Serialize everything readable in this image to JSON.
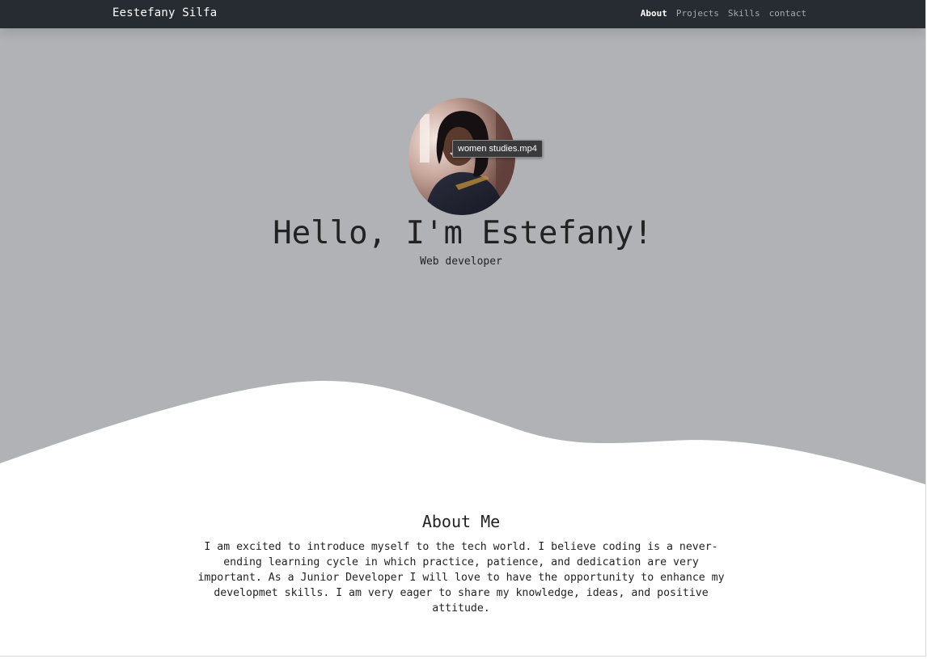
{
  "navbar": {
    "brand": "Eestefany Silfa",
    "links": [
      {
        "label": "About",
        "active": true
      },
      {
        "label": "Projects",
        "active": false
      },
      {
        "label": "Skills",
        "active": false
      },
      {
        "label": "contact",
        "active": false
      }
    ]
  },
  "hero": {
    "title": "Hello, I'm Estefany!",
    "subtitle": "Web developer",
    "background_color": "#b1b2b5",
    "avatar": {
      "icon": "profile-photo"
    },
    "tooltip": "women studies.mp4"
  },
  "about": {
    "title": "About Me",
    "text": "I am excited to introduce myself to the tech world. I believe coding is a never-ending learning cycle in which practice, patience, and dedication are very important. As a Junior Developer I will love to have the opportunity to enhance my developmet skills. I am very eager to share my knowledge, ideas, and positive attitude."
  },
  "colors": {
    "navbar": "#272c33",
    "nav_active": "#ffffff",
    "nav_inactive": "#a6a9ae",
    "hero_bg": "#b1b2b5",
    "text": "#222222"
  }
}
